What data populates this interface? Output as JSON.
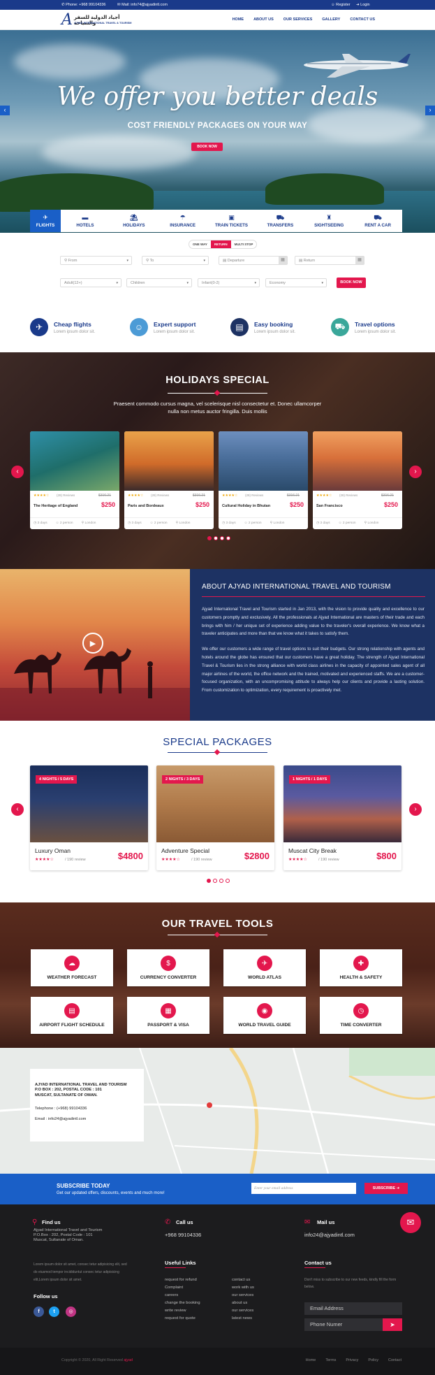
{
  "topbar": {
    "phone": "Phone: +968 99104336",
    "mail": "Mail: info74@ajyadintl.com",
    "register": "Register",
    "login": "Login"
  },
  "logo": {
    "letter": "A",
    "arabic": "أجياد الدولية للسفر والسياحة",
    "english": "AJYAD INTERNATIONAL TRAVEL & TOURISM"
  },
  "nav": [
    "HOME",
    "ABOUT US",
    "OUR SERVICES",
    "GALLERY",
    "CONTACT US"
  ],
  "hero": {
    "headline": "We offer you better deals",
    "subheadline": "COST FRIENDLY PACKAGES ON YOUR WAY",
    "button": "BOOK NOW"
  },
  "tabs": [
    {
      "label": "FLIGHTS",
      "icon": "plane-icon",
      "glyph": "✈"
    },
    {
      "label": "HOTELS",
      "icon": "bed-icon",
      "glyph": "▬"
    },
    {
      "label": "HOLIDAYS",
      "icon": "beach-icon",
      "glyph": "⛱"
    },
    {
      "label": "INSURANCE",
      "icon": "insurance-icon",
      "glyph": "☂"
    },
    {
      "label": "TRAIN TICKETS",
      "icon": "train-icon",
      "glyph": "▣"
    },
    {
      "label": "TRANSFERS",
      "icon": "car-icon",
      "glyph": "⛟"
    },
    {
      "label": "SIGHTSEEING",
      "icon": "sightseeing-icon",
      "glyph": "♜"
    },
    {
      "label": "RENT A CAR",
      "icon": "rent-car-icon",
      "glyph": "⛟"
    }
  ],
  "search": {
    "trip_types": [
      "ONE WAY",
      "RETURN",
      "MULTI STOP"
    ],
    "from": "From",
    "to": "To",
    "departure": "Departure",
    "return": "Return",
    "adult": "Adult(12+)",
    "children": "Children",
    "infant": "Infant(0-2)",
    "class": "Economy",
    "button": "BOOK NOW"
  },
  "features": [
    {
      "title": "Cheap flights",
      "sub": "Lorem ipsum dolor sit.",
      "color": "#1a3a8a",
      "glyph": "✈"
    },
    {
      "title": "Expert support",
      "sub": "Lorem ipsum dolor sit.",
      "color": "#4c9bd6",
      "glyph": "☺"
    },
    {
      "title": "Easy booking",
      "sub": "Lorem ipsum dolor sit.",
      "color": "#1d3263",
      "glyph": "▤"
    },
    {
      "title": "Travel options",
      "sub": "Lorem ipsum dolor sit.",
      "color": "#3aa79a",
      "glyph": "⛟"
    }
  ],
  "holidays": {
    "title": "HOLIDAYS SPECIAL",
    "desc": "Praesent commodo cursus magna, vel scelerisque nisl consectetur et. Donec ullamcorper nulla non metus auctor fringilla. Duis mollis",
    "cards": [
      {
        "name": "The Heritage of England",
        "price": "$250",
        "old": "$316.21",
        "reviews": "(28) Reviews",
        "days": "3 days",
        "persons": "2 person",
        "city": "London"
      },
      {
        "name": "Paris and Bordeaux",
        "price": "$250",
        "old": "$316.21",
        "reviews": "(28) Reviews",
        "days": "3 days",
        "persons": "2 person",
        "city": "London"
      },
      {
        "name": "Cultural Holiday in Bhutan",
        "price": "$250",
        "old": "$316.21",
        "reviews": "(28) Reviews",
        "days": "3 days",
        "persons": "2 person",
        "city": "London"
      },
      {
        "name": "San Francisco",
        "price": "$250",
        "old": "$316.21",
        "reviews": "(28) Reviews",
        "days": "3 days",
        "persons": "2 person",
        "city": "London"
      }
    ],
    "stars": "★★★★☆"
  },
  "about": {
    "title": "ABOUT AJYAD INTERNATIONAL TRAVEL AND TOURISM",
    "p1": "Ajyad International Travel and Tourism started in Jan 2013, with the vision to provide quality and excellence to our customers promptly and exclusively. All the professionals at Ajyad International are masters of their trade and each brings with him / her unique set of experience adding value to the traveler's overall experience. We know what a traveler anticipates and more than that we know what it takes to satisfy them.",
    "p2": "We offer our customers a wide range of travel options to suit their budgets. Our strong relationship with agents and hotels around the globe has ensured that our customers have a great holiday. The strength of Ajyad International Travel & Tourism lies in the strong alliance with world class airlines in the capacity of appointed sales agent of all major airlines of the world, the office network and the trained, motivated and experienced staffs. We are a customer-focused organization, with an uncompromising attitude to always help our clients and provide a lasting solution. From customization to optimization, every requirement is proactively met."
  },
  "packages": {
    "title": "SPECIAL PACKAGES",
    "cards": [
      {
        "badge": "4 NIGHTS / 5 DAYS",
        "name": "Luxury Oman",
        "price": "$4800",
        "reviews": "/ 190 review"
      },
      {
        "badge": "2 NIGHTS / 3 DAYS",
        "name": "Adventure Special",
        "price": "$2800",
        "reviews": "/ 190 review"
      },
      {
        "badge": "1 NIGHTS / 1 DAYS",
        "name": "Muscat City Break",
        "price": "$800",
        "reviews": "/ 190 review"
      }
    ],
    "stars": "★★★★☆"
  },
  "tools": {
    "title": "OUR TRAVEL TOOLS",
    "items": [
      {
        "label": "WEATHER FORECAST",
        "glyph": "☁"
      },
      {
        "label": "CURRENCY CONVERTER",
        "glyph": "$"
      },
      {
        "label": "WORLD ATLAS",
        "glyph": "✈"
      },
      {
        "label": "HEALTH & SAFETY",
        "glyph": "✚"
      },
      {
        "label": "AIRPORT FLIGHT SCHEDULE",
        "glyph": "▤"
      },
      {
        "label": "PASSPORT & VISA",
        "glyph": "▦"
      },
      {
        "label": "WORLD TRAVEL GUIDE",
        "glyph": "◉"
      },
      {
        "label": "TIME CONVERTER",
        "glyph": "◷"
      }
    ]
  },
  "address": {
    "line1": "AJYAD INTERNATIONAL TRAVEL AND TOURISM",
    "line2": "P.O BOX : 202, POSTAL CODE : 101",
    "line3": "MUSCAT, SULTANATE OF OMAN.",
    "phone": "Telephone : (+968) 99104336",
    "email": "Email : info24@ajyadintl.com"
  },
  "subscribe": {
    "title": "SUBSCRIBE TODAY",
    "sub": "Get our updated offers, discounts, events and much more!",
    "placeholder": "Enter your email address",
    "button": "SUBSCRIBE"
  },
  "footer": {
    "find_us": "Find us",
    "find_text1": "Ajyad International Travel and Tourism",
    "find_text2": "P.O.Box : 202, Postal Code : 101",
    "find_text3": "Muscat, Sultanate of Oman.",
    "call_us": "Call us",
    "call_text": "+968 99104336",
    "mail_us": "Mail us",
    "mail_text": "info24@ajyadintl.com",
    "lorem": "Lorem ipsum dolor sit amet, consec tetur adipisicing elit, sed do eiusmod tempor incididuntut consec tetur adipisicing elit,Lorem ipsum dolor sit amet.",
    "follow": "Follow us",
    "useful": "Useful Links",
    "links_left": [
      "request for refund",
      "Complaint",
      "careers",
      "change the booking",
      "write review",
      "request for quote"
    ],
    "links_right": [
      "contact us",
      "work with us",
      "our services",
      "about us",
      "our services",
      "latest news"
    ],
    "contact": "Contact us",
    "contact_text": "Don't miss to subscribe to our new feeds, kindly fill the form below.",
    "email_ph": "Email Address",
    "phone_ph": "Phone Numer",
    "copyright": "Copyright © 2020, All Right Reserved",
    "copyright_brand": "ajyad",
    "bottom_nav": [
      "Home",
      "Terms",
      "Privacy",
      "Policy",
      "Contact"
    ]
  }
}
